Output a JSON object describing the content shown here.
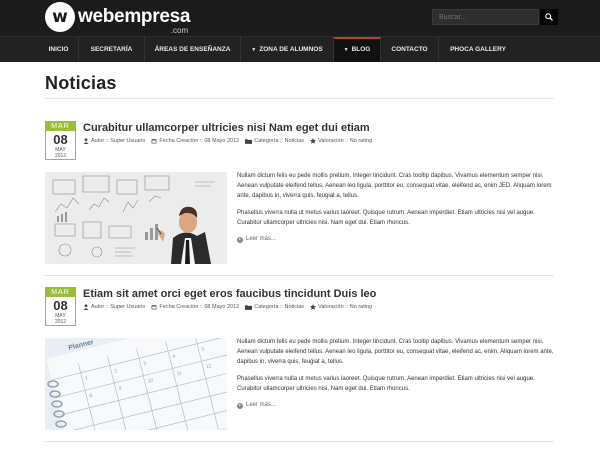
{
  "header": {
    "logo_mark": "w",
    "logo_name": "webempresa",
    "logo_suffix": ".com",
    "search_placeholder": "Buscar..."
  },
  "nav": {
    "items": [
      {
        "label": "INICIO",
        "caret": "",
        "active": false
      },
      {
        "label": "SECRETARÍA",
        "caret": "",
        "active": false
      },
      {
        "label": "ÁREAS DE ENSEÑANZA",
        "caret": "",
        "active": false
      },
      {
        "label": "ZONA DE ALUMNOS",
        "caret": "▼",
        "active": false
      },
      {
        "label": "BLOG",
        "caret": "▼",
        "active": true
      },
      {
        "label": "CONTACTO",
        "caret": "",
        "active": false
      },
      {
        "label": "PHOCA GALLERY",
        "caret": "",
        "active": false
      }
    ],
    "active_color": "#c0392b"
  },
  "page": {
    "title": "Noticias"
  },
  "articles": [
    {
      "date": {
        "month": "MAR",
        "day": "08",
        "month2": "MAY",
        "year": "2012"
      },
      "title": "Curabitur ullamcorper ultricies nisi Nam eget dui etiam",
      "meta": {
        "author_label": "Autor :: Super Usuario",
        "created_label": "Fecha Creación :: 08 Mayo 2012",
        "category_label": "Categoría ::",
        "category_value": "Noticias",
        "rating_label": "Valoración :: No rating"
      },
      "image": "businessman-drawing-charts",
      "paragraphs": [
        "Nullam dictum felis eu pede mollis pretium. Integer tincidunt. Cras tooltip dapibus. Vivamus elementum semper nisi. Aenean vulputate eleifend tellus. Aenean leo ligula, porttitor eu, consequat vitae, eleifend ac, enim JED. Aliquam lorem ante, dapibus in, viverra quis, feugiat a, tellus.",
        "Phasellus viverra nulla ut metus varius laoreet. Quisque rutrum. Aenean imperdiet. Etiam ultricies nisi vel augue. Curabitur ullamcorper ultricies nisi. Nam eget dui. Etiam rhoncus."
      ],
      "read_more": "Leer más..."
    },
    {
      "date": {
        "month": "MAR",
        "day": "08",
        "month2": "MAY",
        "year": "2012"
      },
      "title": "Etiam sit amet orci eget eros faucibus tincidunt Duis leo",
      "meta": {
        "author_label": "Autor :: Super Usuario",
        "created_label": "Fecha Creación :: 08 Mayo 2012",
        "category_label": "Categoría ::",
        "category_value": "Noticias",
        "rating_label": "Valoración :: No rating"
      },
      "image": "planner-calendar",
      "image_caption": "Planner",
      "paragraphs": [
        "Nullam dictum felis eu pede mollis pretium. Integer tincidunt. Cras tooltip dapibus. Vivamus elementum semper nisi. Aenean vulputate eleifend tellus. Aenean leo ligula, porttitor eu, consequat vitae, eleifend ac, enim. Aliquam lorem ante, dapibus in, viverra quis, feugiat a, tellus.",
        "Phasellus viverra nulla ut metus varius laoreet. Quisque rutrum. Aenean imperdiet. Etiam ultricies nisi vel augue. Curabitur ullamcorper ultricies nisi. Nam eget dui. Etiam rhoncus."
      ],
      "read_more": "Leer más..."
    }
  ]
}
